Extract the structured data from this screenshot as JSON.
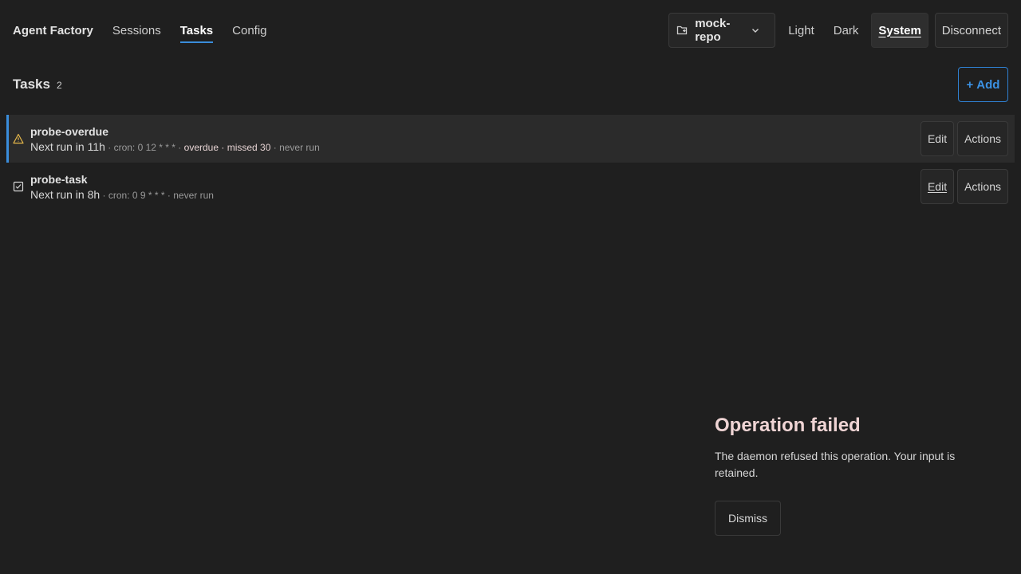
{
  "header": {
    "brand": "Agent Factory",
    "nav": [
      {
        "label": "Sessions"
      },
      {
        "label": "Tasks",
        "active": true
      },
      {
        "label": "Config"
      }
    ],
    "repo": {
      "label": "mock-repo",
      "icon": "repo-icon"
    },
    "themes": [
      {
        "label": "Light"
      },
      {
        "label": "Dark"
      },
      {
        "label": "System",
        "active": true
      }
    ],
    "disconnect_label": "Disconnect"
  },
  "tasks": {
    "title": "Tasks",
    "count": "2",
    "add_label": "Add",
    "add_icon": "+",
    "rows": [
      {
        "name": "probe-overdue",
        "icon": "warning-icon",
        "next_run": "Next run in 11h",
        "cron": "cron: 0 12 * * *",
        "overdue": "overdue",
        "missed": "missed 30",
        "last_run": "never run",
        "edit_label": "Edit",
        "actions_label": "Actions"
      },
      {
        "name": "probe-task",
        "icon": "checkbox-icon",
        "next_run": "Next run in 8h",
        "cron": "cron: 0 9 * * *",
        "last_run": "never run",
        "edit_label": "Edit",
        "actions_label": "Actions"
      }
    ]
  },
  "error": {
    "title": "Operation failed",
    "message": "The daemon refused this operation. Your input is retained.",
    "dismiss_label": "Dismiss"
  },
  "colors": {
    "background": "#1f1f1f",
    "accent": "#3a8ddb",
    "warning": "#e6b84a"
  }
}
